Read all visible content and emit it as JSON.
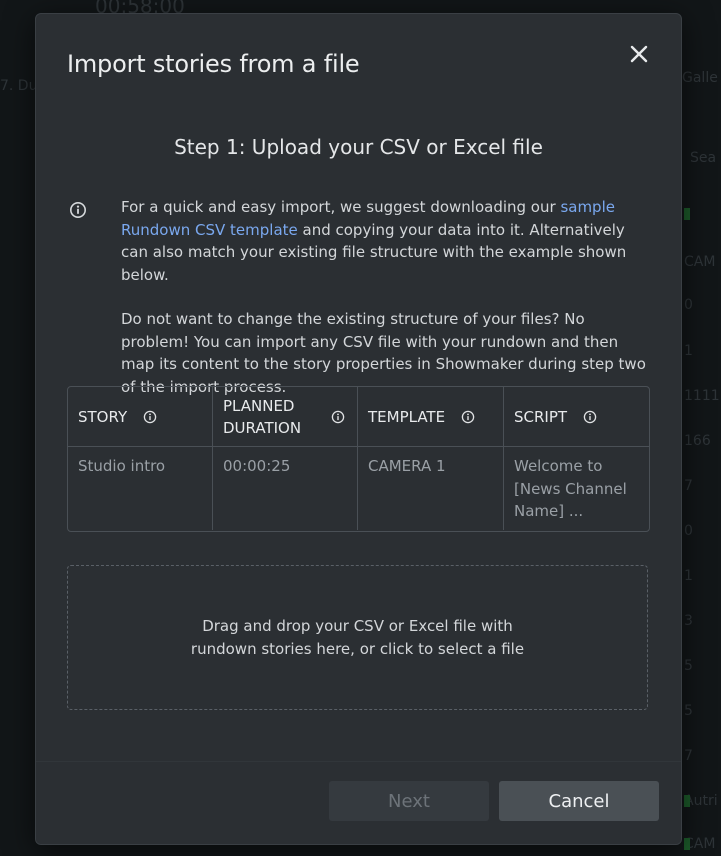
{
  "background": {
    "fragments": [
      "00:58:00",
      "7. Du",
      "Galle",
      "Sea",
      "CAM",
      "0",
      "1",
      "1111",
      "166",
      "7",
      "0",
      "1",
      "3",
      "5",
      "5",
      "7",
      "Autri",
      "CAM"
    ]
  },
  "dialog": {
    "title": "Import stories from a file",
    "close_icon": "close-icon",
    "step_title": "Step 1: Upload your CSV or Excel file",
    "intro": {
      "part1": "For a quick and easy import, we suggest downloading our ",
      "link": "sample Rundown CSV template",
      "part2": " and copying your data into it. Alternatively can also match your existing file structure with the example shown below.",
      "paragraph2": "Do not want to change the existing structure of your files? No problem! You can import any CSV file with your rundown and then map its content to the story properties in Showmaker during step two of the import process."
    },
    "example_table": {
      "headers": [
        "STORY",
        "PLANNED DURATION",
        "TEMPLATE",
        "SCRIPT"
      ],
      "row": [
        "Studio intro",
        "00:00:25",
        "CAMERA 1",
        "Welcome to [News Channel Name] ..."
      ]
    },
    "dropzone_text": "Drag and drop your CSV or Excel file with rundown stories here, or click to select a file",
    "buttons": {
      "next": "Next",
      "cancel": "Cancel"
    }
  },
  "colors": {
    "accent_link": "#7aa8ef",
    "modal_bg": "#2b2f33",
    "button_disabled_text": "#6d7379"
  }
}
